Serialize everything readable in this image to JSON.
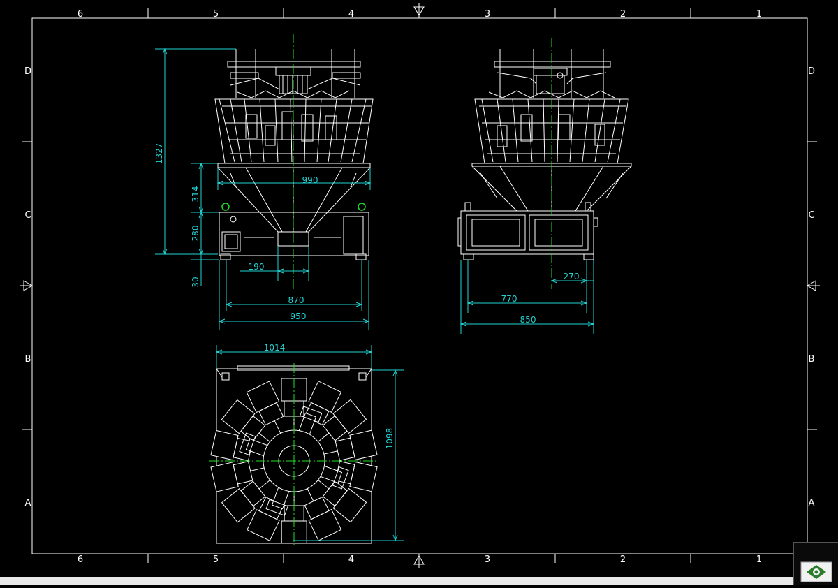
{
  "frame": {
    "top_columns": [
      "6",
      "5",
      "4",
      "3",
      "2",
      "1"
    ],
    "bottom_columns": [
      "6",
      "5",
      "4",
      "3",
      "2",
      "1"
    ],
    "left_rows": [
      "D",
      "C",
      "B",
      "A"
    ],
    "right_rows": [
      "D",
      "C",
      "B",
      "A"
    ]
  },
  "front_view": {
    "dims": {
      "height_total": "1327",
      "hopper_height": "314",
      "base_height": "280",
      "foot_height": "30",
      "hopper_width": "990",
      "chute_width": "190",
      "foot_span": "870",
      "base_width": "950"
    }
  },
  "side_view": {
    "dims": {
      "offset": "270",
      "foot_span": "770",
      "base_width": "850"
    }
  },
  "top_view": {
    "dims": {
      "width": "1014",
      "depth": "1098"
    }
  },
  "colors": {
    "background": "#000000",
    "line": "#ffffff",
    "dimension": "#22d3d3",
    "centerline": "#22dd22",
    "statusbar": "#e8e8e8"
  },
  "icons": {
    "corner": "app-logo-icon"
  }
}
